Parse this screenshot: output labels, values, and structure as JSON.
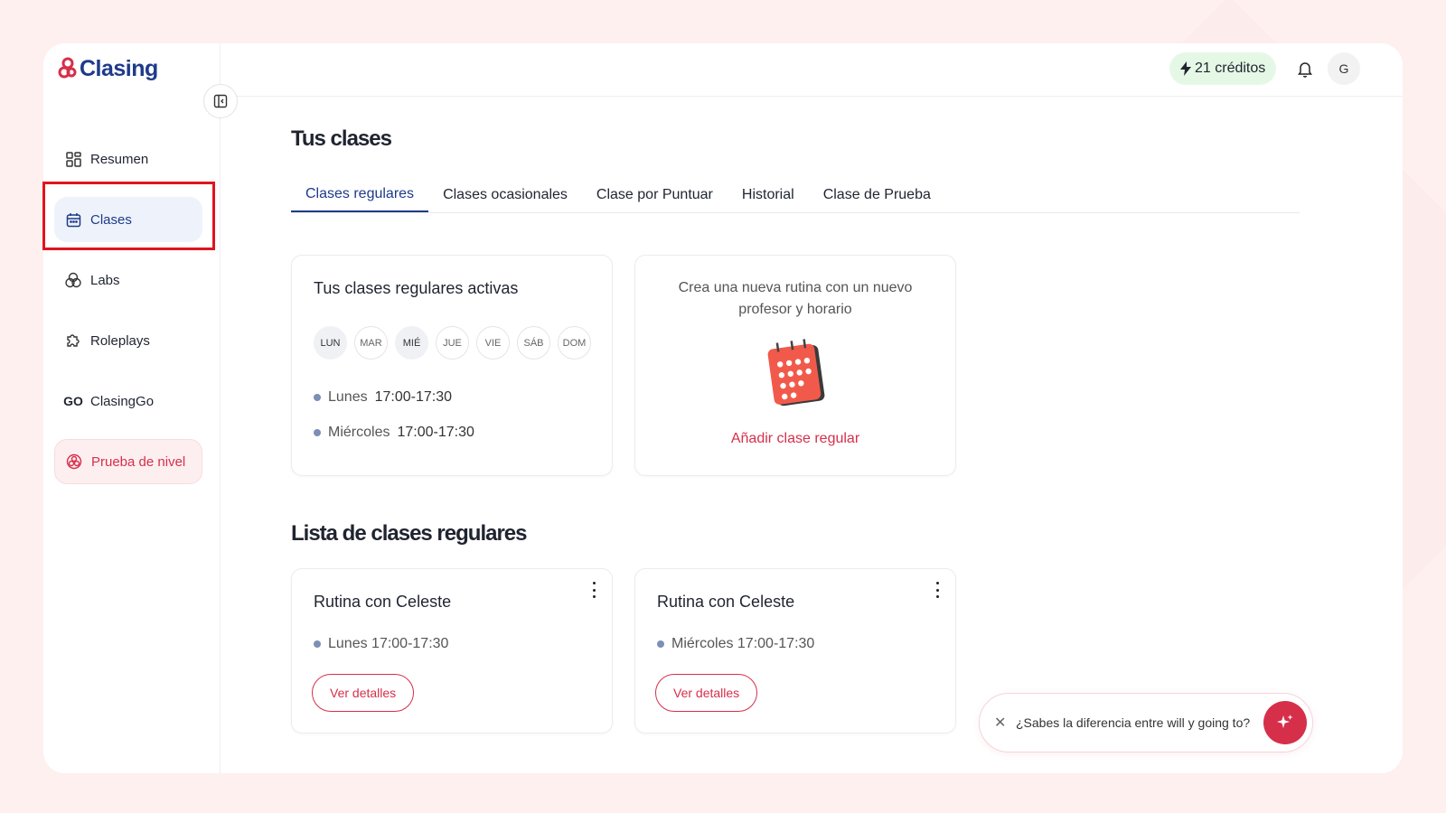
{
  "brand": {
    "name": "Clasing",
    "accent": "#d62f4a",
    "primary": "#1e3a8a"
  },
  "sidebar": {
    "collapse_icon": "sidebar-collapse-icon",
    "items": [
      {
        "label": "Resumen",
        "icon": "dashboard-icon"
      },
      {
        "label": "Clases",
        "icon": "calendar-icon",
        "active": true
      },
      {
        "label": "Labs",
        "icon": "labs-icon"
      },
      {
        "label": "Roleplays",
        "icon": "puzzle-icon"
      },
      {
        "label": "ClasingGo",
        "icon_text": "GO"
      },
      {
        "label": "Prueba de nivel",
        "icon": "level-test-icon"
      }
    ]
  },
  "header": {
    "credits": "21 créditos",
    "avatar_initial": "G"
  },
  "main": {
    "title": "Tus clases",
    "tabs": [
      {
        "label": "Clases regulares",
        "active": true
      },
      {
        "label": "Clases ocasionales"
      },
      {
        "label": "Clase por Puntuar"
      },
      {
        "label": "Historial"
      },
      {
        "label": "Clase de Prueba"
      }
    ],
    "active_card": {
      "title": "Tus clases regulares activas",
      "days": [
        "LUN",
        "MAR",
        "MIÉ",
        "JUE",
        "VIE",
        "SÁB",
        "DOM"
      ],
      "active_days": [
        "LUN",
        "MIÉ"
      ],
      "schedules": [
        {
          "day": "Lunes",
          "time": "17:00-17:30"
        },
        {
          "day": "Miércoles",
          "time": "17:00-17:30"
        }
      ]
    },
    "new_card": {
      "text": "Crea una nueva rutina con un nuevo profesor y horario",
      "link": "Añadir clase regular"
    },
    "list_title": "Lista de clases regulares",
    "routines": [
      {
        "title": "Rutina con Celeste",
        "schedule": "Lunes 17:00-17:30",
        "button": "Ver detalles"
      },
      {
        "title": "Rutina con Celeste",
        "schedule": "Miércoles 17:00-17:30",
        "button": "Ver detalles"
      }
    ]
  },
  "chat_prompt": {
    "text": "¿Sabes la diferencia entre will y going to?"
  }
}
